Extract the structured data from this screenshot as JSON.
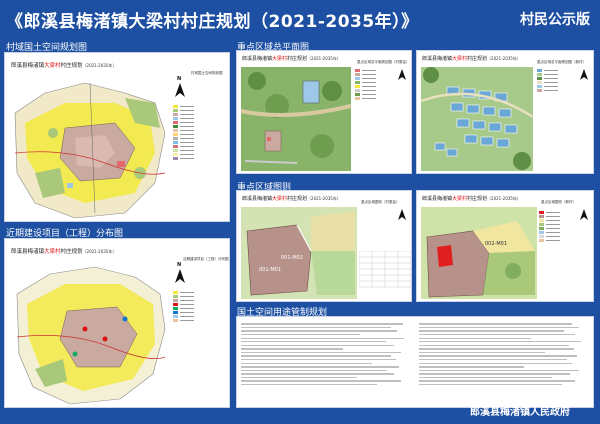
{
  "header": {
    "title": "《郎溪县梅渚镇大梁村村庄规划（2021-2035年）》",
    "edition": "村民公示版"
  },
  "sections": {
    "village_space": "村域国土空间规划图",
    "near_term": "近期建设项目（工程）分布图",
    "key_area_plan": "重点区域总平面图",
    "key_area_zoning": "重点区域图则",
    "land_control": "国土空间用途管制规划"
  },
  "maps": {
    "common_prefix": "郎溪县梅渚镇",
    "village_name": "大梁村",
    "common_suffix": "村庄规划",
    "year": "（2021-2035年）",
    "village_space_subtitle": "村域国土空间规划图",
    "near_term_subtitle": "近期建设项目（工程）分布图",
    "plan_a_subtitle": "重点区域总平面规划图（村委会）",
    "plan_b_subtitle": "重点区域总平面规划图（新村）",
    "zone_a_subtitle": "重点区域图则（村委会）",
    "zone_b_subtitle": "重点区域图则（新村）",
    "zone_a_parcel_1": "001-M01",
    "zone_a_parcel_2": "001-M02",
    "zone_b_parcel": "002-M01"
  },
  "compass_label": "N",
  "colors": {
    "background": "#1d4fa2",
    "panel": "#ffffff",
    "village_name": "#dd1111",
    "farmland": "#f3ea3c",
    "forest": "#a9c87a",
    "construction": "#c9a9a0",
    "water": "#9ec8e8",
    "industrial": "#e36b6b"
  },
  "footer": "郎溪县梅渚镇人民政府"
}
